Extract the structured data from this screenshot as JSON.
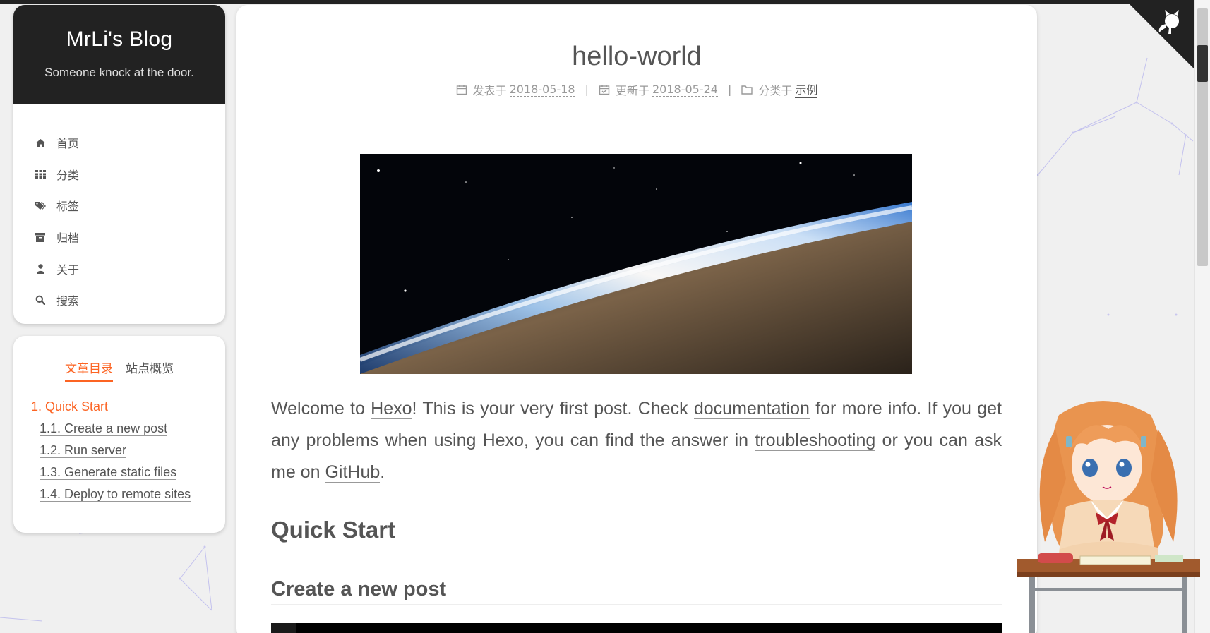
{
  "site": {
    "title": "MrLi's Blog",
    "subtitle": "Someone knock at the door."
  },
  "menu": {
    "items": [
      {
        "label": "首页",
        "icon": "home-icon"
      },
      {
        "label": "分类",
        "icon": "th-icon"
      },
      {
        "label": "标签",
        "icon": "tags-icon"
      },
      {
        "label": "归档",
        "icon": "archive-icon"
      },
      {
        "label": "关于",
        "icon": "user-icon"
      },
      {
        "label": "搜索",
        "icon": "search-icon"
      }
    ]
  },
  "toc": {
    "tabs": [
      "文章目录",
      "站点概览"
    ],
    "active_tab": "文章目录",
    "items": [
      {
        "label": "1. Quick Start",
        "level": 1,
        "active": true
      },
      {
        "label": "1.1. Create a new post",
        "level": 2
      },
      {
        "label": "1.2. Run server",
        "level": 2
      },
      {
        "label": "1.3. Generate static files",
        "level": 2
      },
      {
        "label": "1.4. Deploy to remote sites",
        "level": 2
      }
    ]
  },
  "post": {
    "title": "hello-world",
    "meta": {
      "posted_label": "发表于",
      "posted_date": "2018-05-18",
      "updated_label": "更新于",
      "updated_date": "2018-05-24",
      "category_label": "分类于",
      "category": "示例",
      "separator": "|"
    },
    "paragraph": {
      "t1": "Welcome to ",
      "link1": "Hexo",
      "t2": "! This is your very first post. Check ",
      "link2": "documentation",
      "t3": " for more info. If you get any problems when using Hexo, you can find the answer in ",
      "link3": "troubleshooting",
      "t4": " or you can ask me on ",
      "link4": "GitHub",
      "t5": "."
    },
    "h2": "Quick Start",
    "h3": "Create a new post"
  },
  "colors": {
    "accent": "#fc6423",
    "brand_bg": "#222222",
    "text": "#555555"
  }
}
